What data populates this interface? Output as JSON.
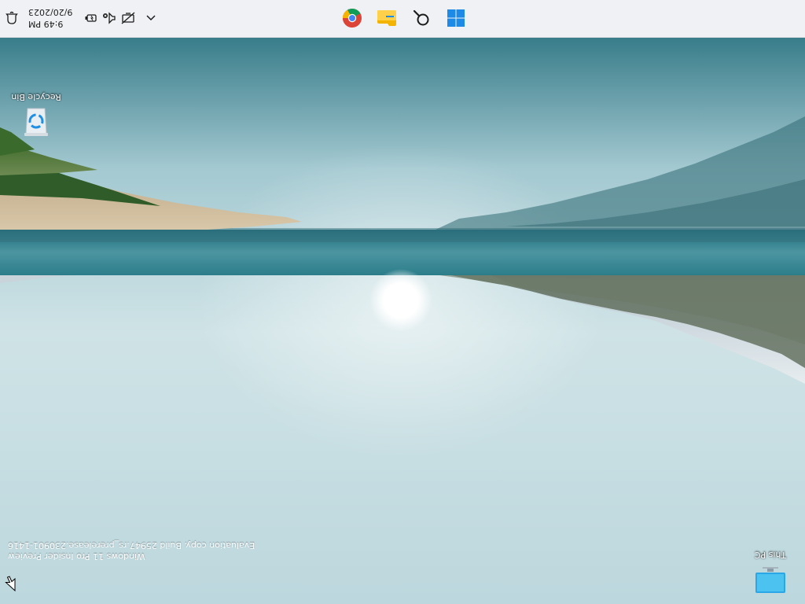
{
  "desktop": {
    "orientation_degrees": 180,
    "icons": [
      {
        "label": "This PC",
        "icon": "this-pc-icon"
      },
      {
        "label": "Recycle Bin",
        "icon": "recycle-bin-icon"
      }
    ],
    "watermark": {
      "line1": "Windows 11 Pro Insider Preview",
      "line2": "Evaluation copy. Build 25947.rs_prerelease.230901-1416"
    }
  },
  "taskbar": {
    "apps": [
      {
        "name": "Start",
        "icon": "windows-start-icon"
      },
      {
        "name": "Search",
        "icon": "search-icon"
      },
      {
        "name": "File Explorer",
        "icon": "file-explorer-icon"
      },
      {
        "name": "Google Chrome",
        "icon": "chrome-icon"
      }
    ],
    "tray": {
      "overflow_icon": "chevron-up-icon",
      "status_icons": [
        "network-icon",
        "volume-icon",
        "battery-icon"
      ]
    },
    "clock": {
      "time": "9:49 PM",
      "date": "9/20/2023"
    },
    "notification_icon": "bell-icon"
  },
  "colors": {
    "taskbar_bg": "#eff1f4",
    "sky_top": "#1f6f7d",
    "sky_bottom": "#b9d6dc",
    "water": "#9ec6d0",
    "start_blue": "#1c8ae6"
  }
}
